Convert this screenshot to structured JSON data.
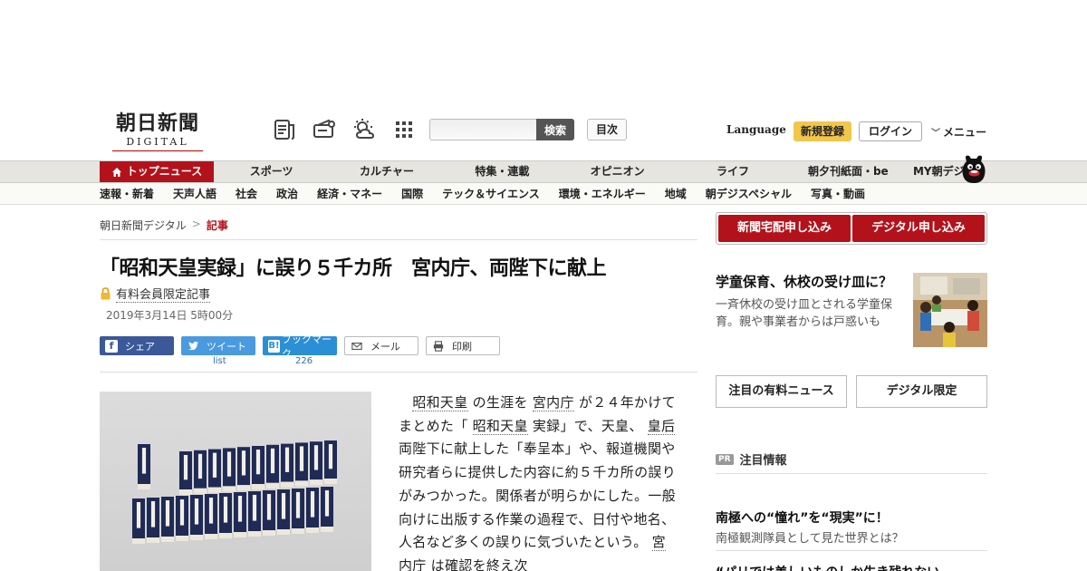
{
  "header": {
    "logo_main": "朝日新聞",
    "logo_sub": "DIGITAL",
    "search_button": "検索",
    "search_placeholder": "",
    "mokuji": "目次",
    "language": "Language",
    "signup": "新規登録",
    "login": "ログイン",
    "menu": "メニュー"
  },
  "nav_primary": [
    {
      "label": "トップニュース",
      "active": true
    },
    {
      "label": "スポーツ"
    },
    {
      "label": "カルチャー"
    },
    {
      "label": "特集・連載"
    },
    {
      "label": "オピニオン"
    },
    {
      "label": "ライフ"
    },
    {
      "label": "朝夕刊紙面・be"
    },
    {
      "label": "MY朝デジ"
    }
  ],
  "nav_secondary": [
    "速報・新着",
    "天声人語",
    "社会",
    "政治",
    "経済・マネー",
    "国際",
    "テック＆サイエンス",
    "環境・エネルギー",
    "地域",
    "朝デジスペシャル",
    "写真・動画"
  ],
  "breadcrumb": {
    "home": "朝日新聞デジタル",
    "sep": ">",
    "current": "記事"
  },
  "article": {
    "headline": "「昭和天皇実録」に誤り５千カ所　宮内庁、両陛下に献上",
    "paid_label": "有料会員限定記事",
    "date": "2019年3月14日 5時00分",
    "share": {
      "facebook": "シェア",
      "twitter": "ツイート",
      "hatena": "ブックマーク",
      "mail": "メール",
      "print": "印刷",
      "twitter_count": "list",
      "hatena_count": "226"
    },
    "body": [
      {
        "t": "　"
      },
      {
        "t": "昭和天皇",
        "link": true
      },
      {
        "t": " の生涯を "
      },
      {
        "t": "宮内庁",
        "link": true
      },
      {
        "t": " が２４年かけてまとめた「 "
      },
      {
        "t": "昭和天皇",
        "link": true
      },
      {
        "t": " 実録」で、天皇、 "
      },
      {
        "t": "皇后",
        "link": true
      },
      {
        "t": " 両陛下に献上した「奉呈本」や、報道機関や研究者らに提供した内容に約５千カ所の誤りがみつかった。関係者が明らかにした。一般向けに出版する作業の過程で、日付や地名、人名など多くの誤りに気づいたという。 "
      },
      {
        "t": "宮内庁",
        "link": true
      },
      {
        "t": " は確認を終え次"
      }
    ]
  },
  "sidebar": {
    "sub_newspaper": "新聞宅配申し込み",
    "sub_digital": "デジタル申し込み",
    "feature_title": "学童保育、休校の受け皿に？",
    "feature_desc": "一斉休校の受け皿とされる学童保育。親や事業者からは戸惑いも",
    "tab_paid": "注目の有料ニュース",
    "tab_digital": "デジタル限定",
    "pr_badge": "PR",
    "pr_label": "注目情報",
    "ad1_title": "南極への“憧れ”を“現実”に！",
    "ad1_desc": "南極観測隊員として見た世界とは？",
    "ad2_title": "“パリでは美しいものしか生き残れない"
  },
  "colors": {
    "brand_red": "#b3121b",
    "signup_yellow": "#f2c64b",
    "facebook": "#3b5998",
    "twitter": "#4a9ae0",
    "hatena": "#2b8fd6"
  }
}
